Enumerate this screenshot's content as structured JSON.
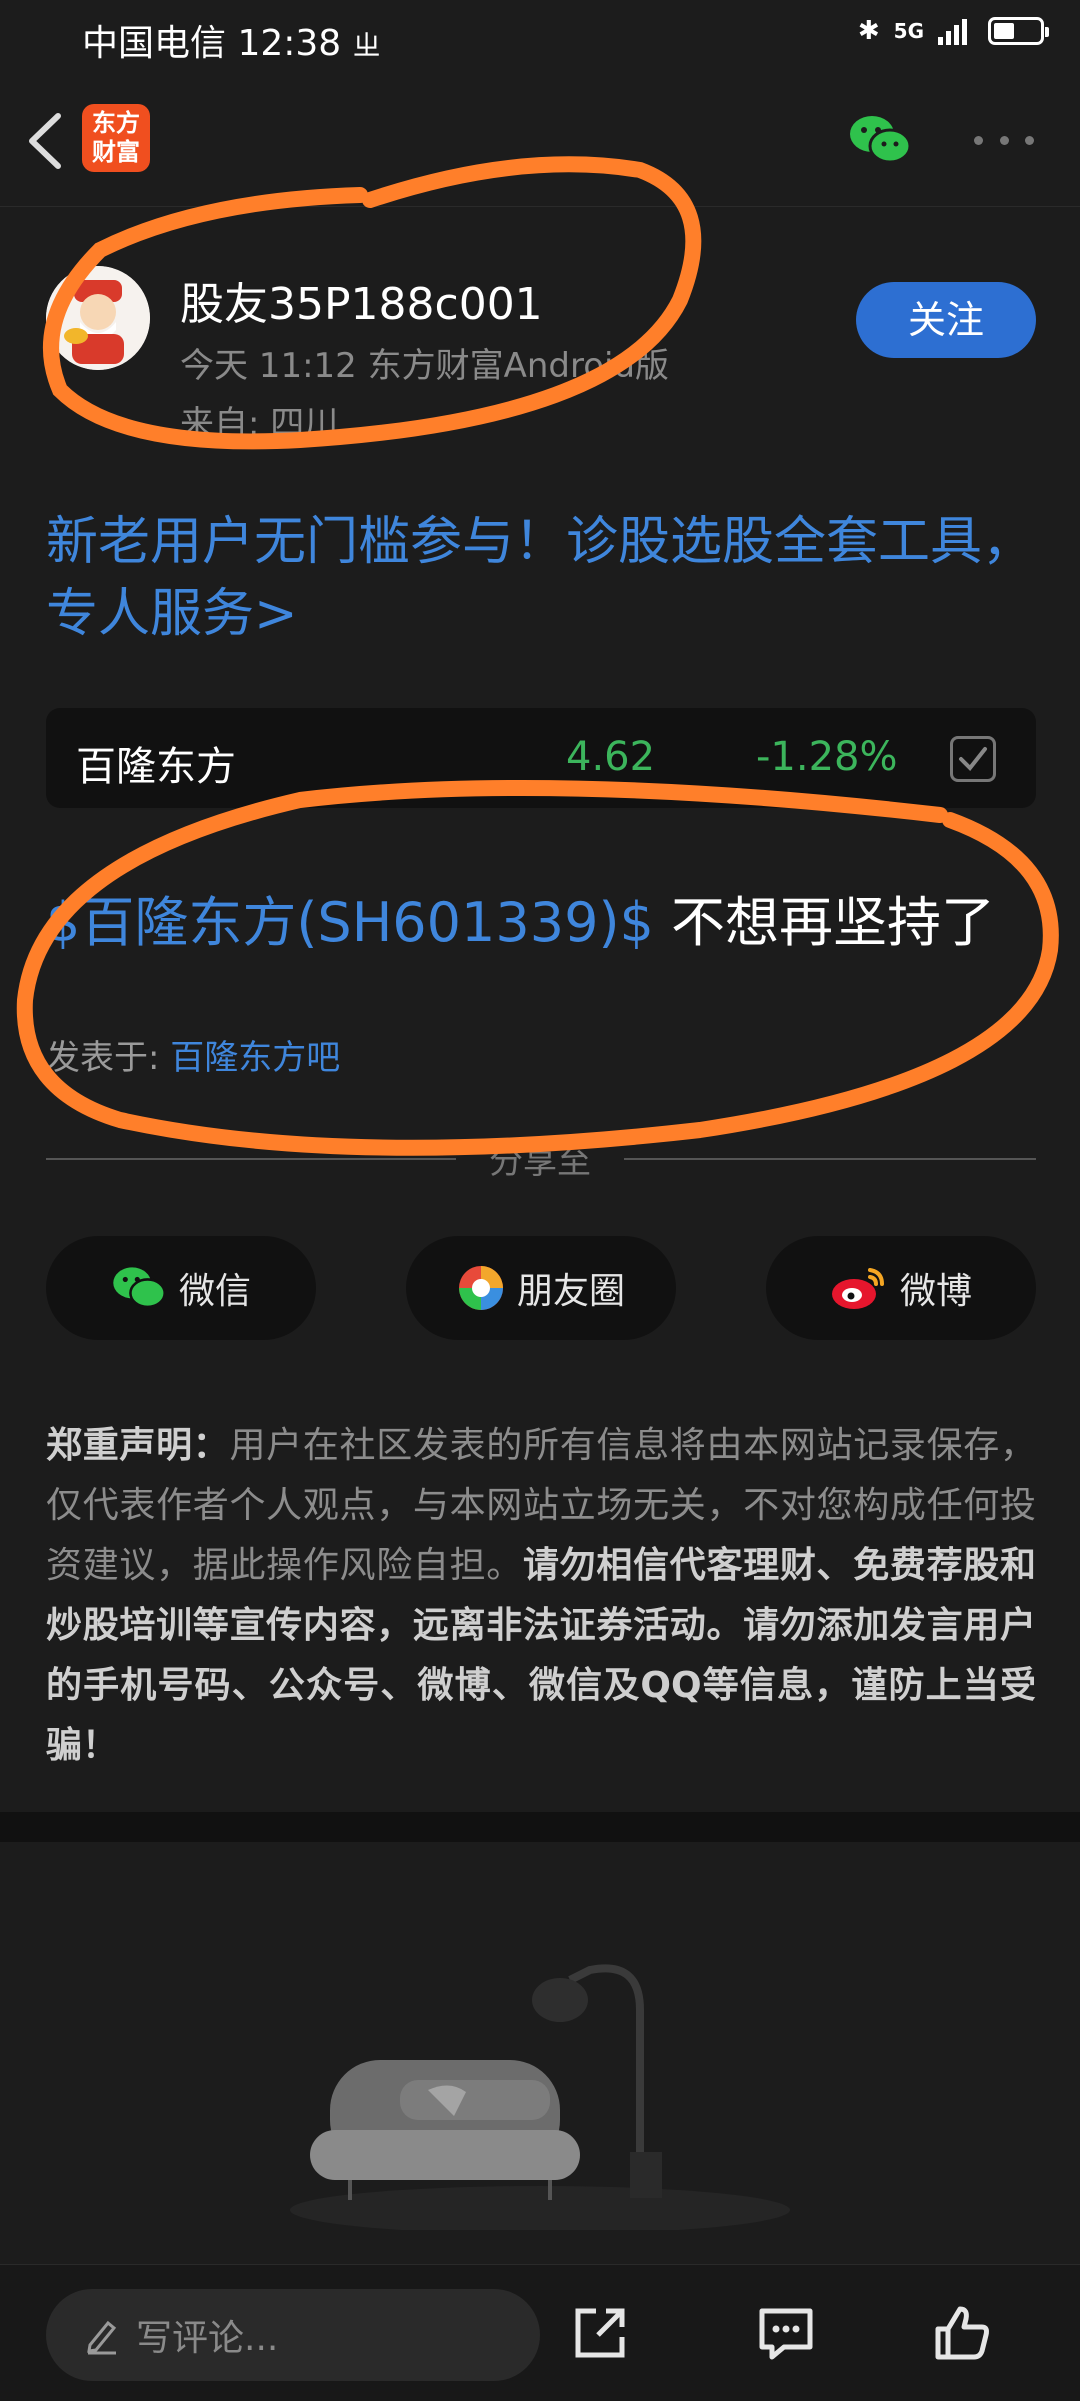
{
  "status_bar": {
    "carrier": "中国电信",
    "time": "12:38",
    "network": "5G",
    "battery_level": 0.45
  },
  "nav": {
    "logo_line1": "东方",
    "logo_line2": "财富",
    "back_icon": "chevron-left-icon",
    "wechat_icon": "wechat-icon",
    "more_icon": "more-dots-icon"
  },
  "author": {
    "name": "股友35P188c001",
    "meta": "今天 11:12 东方财富Android版",
    "origin": "来自: 四川",
    "follow_label": "关注"
  },
  "promo": {
    "text": "新老用户无门槛参与！诊股选股全套工具，专人服务>"
  },
  "stock": {
    "name": "百隆东方",
    "price": "4.62",
    "change": "-1.28%",
    "price_color": "#3cb55c"
  },
  "post": {
    "tag": "$百隆东方(SH601339)$",
    "text": " 不想再坚持了",
    "posted_in_label": "发表于: ",
    "posted_in_bar": "百隆东方吧"
  },
  "share": {
    "label": "分享至",
    "wechat": "微信",
    "moments": "朋友圈",
    "weibo": "微博"
  },
  "disclaimer": {
    "title": "郑重声明：",
    "normal": "用户在社区发表的所有信息将由本网站记录保存，仅代表作者个人观点，与本网站立场无关，不对您构成任何投资建议，据此操作风险自担。",
    "emphasis": "请勿相信代客理财、免费荐股和炒股培训等宣传内容，远离非法证券活动。请勿添加发言用户的手机号码、公众号、微博、微信及QQ等信息，谨防上当受骗！"
  },
  "bottom_bar": {
    "comment_placeholder": "写评论...",
    "share_icon": "share-out-icon",
    "comment_icon": "comment-icon",
    "like_icon": "thumbs-up-icon"
  },
  "colors": {
    "background": "#1c1c1c",
    "link_blue": "#3f86dc",
    "follow_blue": "#2d6fd2",
    "annotation_orange": "#ff7f2a",
    "logo_orange": "#f04f1f"
  }
}
